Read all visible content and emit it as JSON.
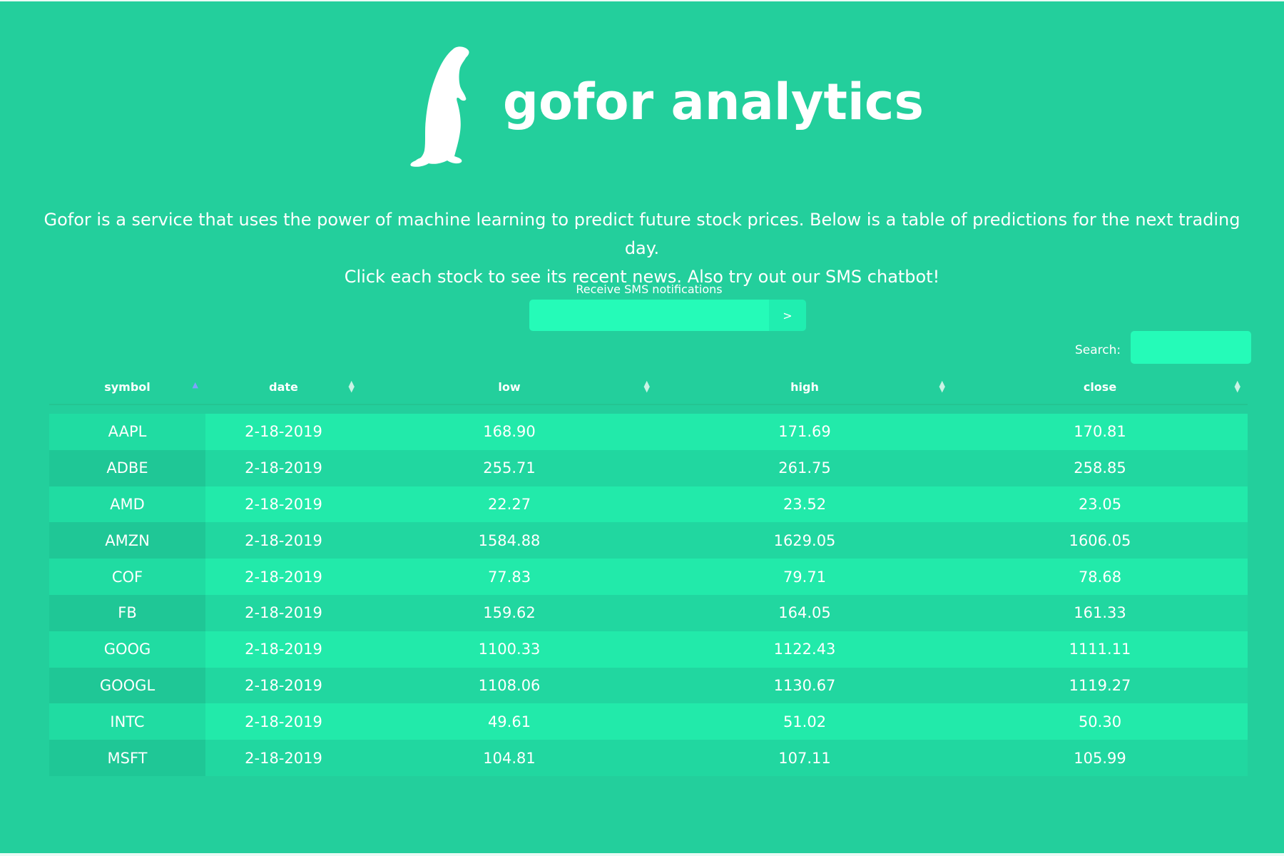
{
  "brand": {
    "name": "gofor analytics",
    "logo_icon": "prairie-dog-icon"
  },
  "intro": {
    "line1": "Gofor is a service that uses the power of machine learning to predict future stock prices. Below is a table of predictions for the next trading day.",
    "line2": "Click each stock to see its recent news. Also try out our SMS chatbot!"
  },
  "sms": {
    "label": "Receive SMS notifications",
    "input_value": "",
    "button_label": ">"
  },
  "search": {
    "label": "Search:",
    "value": ""
  },
  "table": {
    "columns": [
      {
        "label": "symbol"
      },
      {
        "label": "date"
      },
      {
        "label": "low"
      },
      {
        "label": "high"
      },
      {
        "label": "close"
      }
    ],
    "sorted_column": "symbol",
    "rows": [
      [
        "AAPL",
        "2-18-2019",
        "168.90",
        "171.69",
        "170.81"
      ],
      [
        "ADBE",
        "2-18-2019",
        "255.71",
        "261.75",
        "258.85"
      ],
      [
        "AMD",
        "2-18-2019",
        "22.27",
        "23.52",
        "23.05"
      ],
      [
        "AMZN",
        "2-18-2019",
        "1584.88",
        "1629.05",
        "1606.05"
      ],
      [
        "COF",
        "2-18-2019",
        "77.83",
        "79.71",
        "78.68"
      ],
      [
        "FB",
        "2-18-2019",
        "159.62",
        "164.05",
        "161.33"
      ],
      [
        "GOOG",
        "2-18-2019",
        "1100.33",
        "1122.43",
        "1111.11"
      ],
      [
        "GOOGL",
        "2-18-2019",
        "1108.06",
        "1130.67",
        "1119.27"
      ],
      [
        "INTC",
        "2-18-2019",
        "49.61",
        "51.02",
        "50.30"
      ],
      [
        "MSFT",
        "2-18-2019",
        "104.81",
        "107.11",
        "105.99"
      ]
    ]
  },
  "colors": {
    "background": "#23cf9c",
    "row_light": "#22eaaa",
    "row_dark": "#21d7a0",
    "input": "#25fbb8"
  }
}
